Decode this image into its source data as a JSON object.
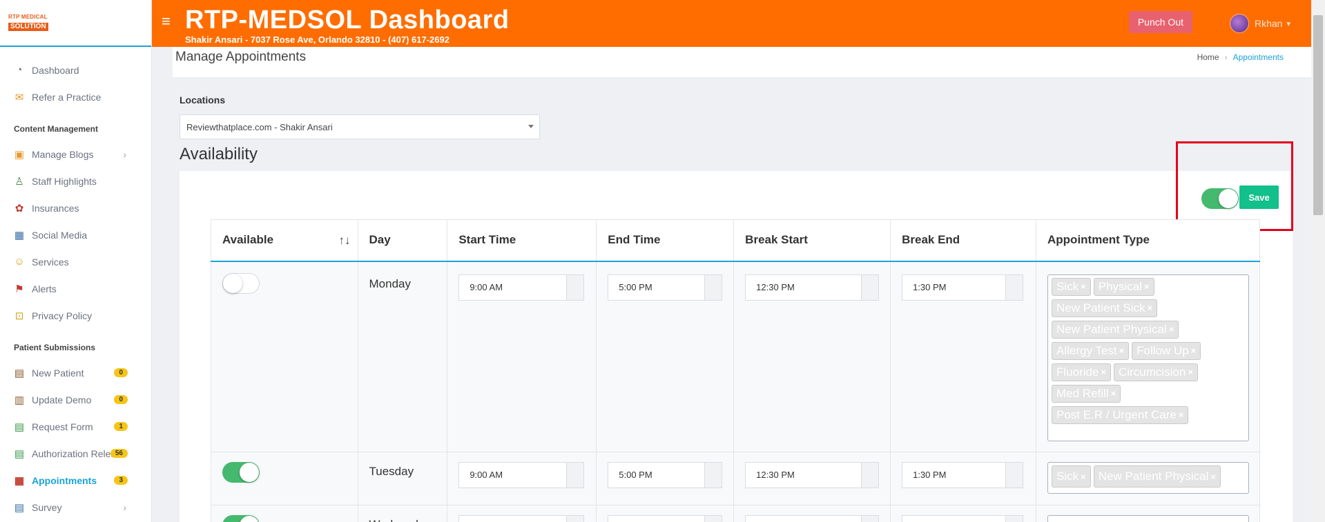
{
  "logo": {
    "line1": "RTP MEDICAL",
    "line2": "SOLUTION"
  },
  "header": {
    "title": "RTP-MEDSOL Dashboard",
    "subtitle": "Shakir Ansari - 7037 Rose Ave, Orlando 32810 - (407) 617-2692",
    "punch_label": "Punch Out",
    "user_name": "Rkhan"
  },
  "sidebar": {
    "top_items": [
      {
        "label": "Dashboard",
        "icon": "gauge-icon"
      },
      {
        "label": "Refer a Practice",
        "icon": "mail-icon"
      }
    ],
    "content_heading": "Content Management",
    "content_items": [
      {
        "label": "Manage Blogs",
        "icon": "blog-icon"
      },
      {
        "label": "Staff Highlights",
        "icon": "staff-icon"
      },
      {
        "label": "Insurances",
        "icon": "insurance-icon"
      },
      {
        "label": "Social Media",
        "icon": "social-icon"
      },
      {
        "label": "Services",
        "icon": "services-icon"
      },
      {
        "label": "Alerts",
        "icon": "alert-icon"
      },
      {
        "label": "Privacy Policy",
        "icon": "lock-icon"
      }
    ],
    "patient_heading": "Patient Submissions",
    "patient_items": [
      {
        "label": "New Patient",
        "badge": "0",
        "icon": "clipboard-icon"
      },
      {
        "label": "Update Demo",
        "badge": "0",
        "icon": "id-card-icon"
      },
      {
        "label": "Request Form",
        "badge": "1",
        "icon": "clipboard-plus-icon"
      },
      {
        "label": "Authorization Release",
        "badge": "56",
        "icon": "clipboard-check-icon"
      },
      {
        "label": "Appointments",
        "badge": "3",
        "icon": "calendar-icon"
      },
      {
        "label": "Survey",
        "icon": "survey-icon"
      }
    ]
  },
  "page": {
    "title": "Manage Appointments",
    "breadcrumb_home": "Home",
    "breadcrumb_current": "Appointments",
    "locations_label": "Locations",
    "location_value": "Reviewthatplace.com - Shakir Ansari",
    "availability_title": "Availability",
    "save_label": "Save",
    "master_toggle_on": true
  },
  "table": {
    "headers": [
      "Available",
      "Day",
      "Start Time",
      "End Time",
      "Break Start",
      "Break End",
      "Appointment Type"
    ],
    "rows": [
      {
        "available": false,
        "day": "Monday",
        "start": "9:00 AM",
        "end": "5:00 PM",
        "break_start": "12:30 PM",
        "break_end": "1:30 PM",
        "types": [
          "Sick",
          "Physical",
          "New Patient Sick",
          "New Patient Physical",
          "Allergy Test",
          "Follow Up",
          "Fluoride",
          "Circumcision",
          "Med Refill",
          "Post E.R / Urgent Care"
        ]
      },
      {
        "available": true,
        "day": "Tuesday",
        "start": "9:00 AM",
        "end": "5:00 PM",
        "break_start": "12:30 PM",
        "break_end": "1:30 PM",
        "types": [
          "Sick",
          "New Patient Physical"
        ]
      },
      {
        "available": true,
        "day": "Wednesd",
        "start": "",
        "end": "",
        "break_start": "",
        "break_end": "",
        "types": [
          "",
          ""
        ]
      }
    ]
  },
  "colors": {
    "brand_orange": "#ff6d00",
    "accent_blue": "#1aa3d9",
    "toggle_green": "#45b96e",
    "save_green": "#11c08a",
    "highlight_red": "#e3001b"
  }
}
